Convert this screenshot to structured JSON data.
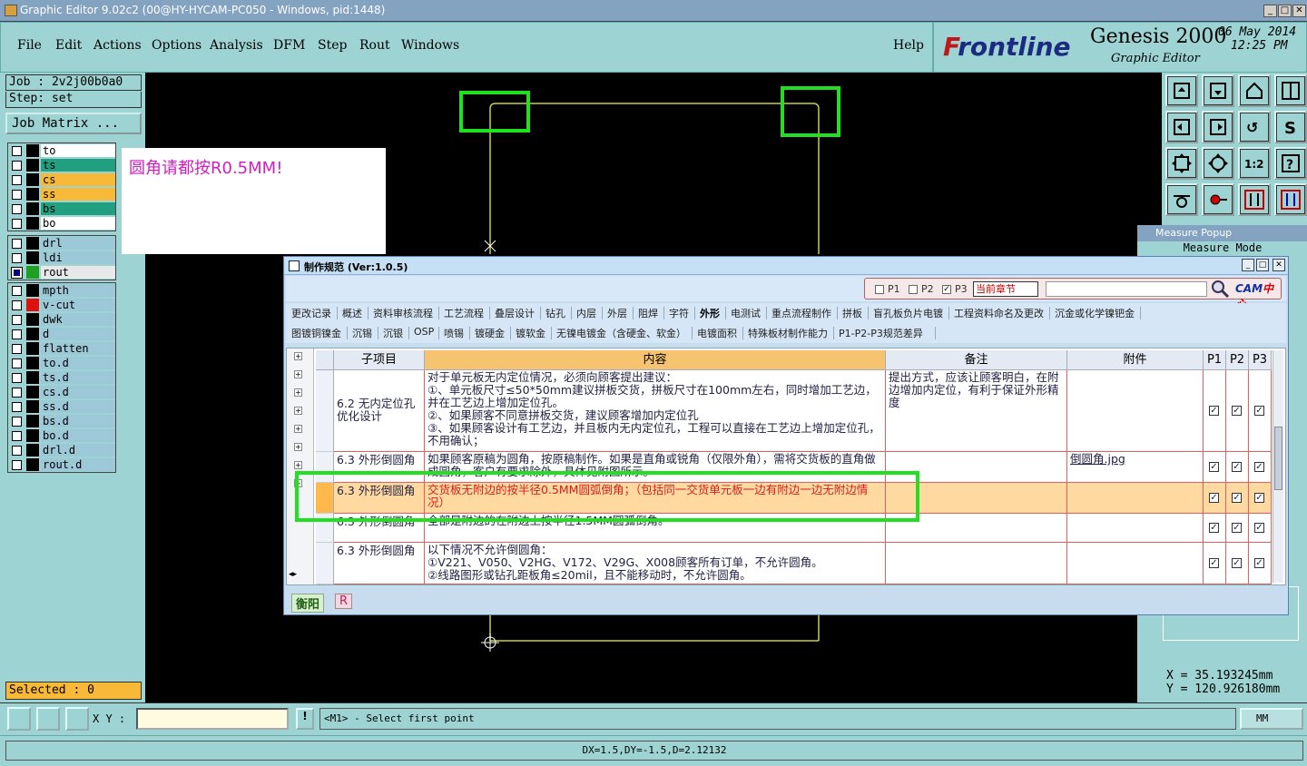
{
  "titlebar": {
    "title": "Graphic Editor 9.02c2 (00@HY-HYCAM-PC050 - Windows, pid:1448)"
  },
  "menu": {
    "items": [
      "File",
      "Edit",
      "Actions",
      "Options",
      "Analysis",
      "DFM",
      "Step",
      "Rout",
      "Windows"
    ],
    "help": "Help"
  },
  "brand": {
    "logo_a": "F",
    "logo_b": "r",
    "logo_c": "ontline",
    "product": "Genesis 2000",
    "subtitle": "Graphic Editor",
    "date": "06 May 2014",
    "time": "12:25 PM"
  },
  "job": {
    "job_text": "Job : 2v2j00b0a0",
    "step_text": "Step: set",
    "matrix_btn": "Job Matrix ..."
  },
  "layers": {
    "group1": [
      {
        "name": "to",
        "color": "#ffffff"
      },
      {
        "name": "ts",
        "color": "#20a080"
      },
      {
        "name": "cs",
        "color": "#f8b838"
      },
      {
        "name": "ss",
        "color": "#f8b838"
      },
      {
        "name": "bs",
        "color": "#20a080"
      },
      {
        "name": "bo",
        "color": "#ffffff"
      }
    ],
    "group2": [
      {
        "name": "drl",
        "color": "#9dc8d8"
      },
      {
        "name": "ldi",
        "color": "#9dc8d8"
      },
      {
        "name": "rout",
        "color": "#e8e8e8"
      }
    ],
    "group3": [
      {
        "name": "mpth",
        "color": "#9dc8d8"
      },
      {
        "name": "v-cut",
        "color": "#9dc8d8"
      },
      {
        "name": "dwk",
        "color": "#9dc8d8"
      },
      {
        "name": "d",
        "color": "#9dc8d8"
      },
      {
        "name": "flatten",
        "color": "#9dc8d8"
      },
      {
        "name": "to.d",
        "color": "#9dc8d8"
      },
      {
        "name": "ts.d",
        "color": "#9dc8d8"
      },
      {
        "name": "cs.d",
        "color": "#9dc8d8"
      },
      {
        "name": "ss.d",
        "color": "#9dc8d8"
      },
      {
        "name": "bs.d",
        "color": "#9dc8d8"
      },
      {
        "name": "bo.d",
        "color": "#9dc8d8"
      },
      {
        "name": "drl.d",
        "color": "#9dc8d8"
      },
      {
        "name": "rout.d",
        "color": "#9dc8d8"
      }
    ]
  },
  "selected": "Selected : 0",
  "note": "圆角请都按R0.5MM!",
  "measure": {
    "title": "Measure Popup",
    "mode": "Measure Mode",
    "x": "X = 35.193245mm",
    "y": "Y = 120.926180mm"
  },
  "bottom": {
    "xy_label": "X Y :",
    "prompt": "<M1> - Select first point",
    "units": "MM",
    "status": "DX=1.5,DY=-1.5,D=2.12132"
  },
  "dialog": {
    "title": "制作规范 (Ver:1.0.5)",
    "filters": [
      "P1",
      "P2",
      "P3"
    ],
    "chapter": "当前章节",
    "cam_a": "CAM",
    "cam_b": "中心",
    "tabs1": [
      "更改记录",
      "概述",
      "资料审核流程",
      "工艺流程",
      "叠层设计",
      "钻孔",
      "内层",
      "外层",
      "阻焊",
      "字符",
      "外形",
      "电测试",
      "重点流程制作",
      "拼板",
      "盲孔板负片电镀",
      "工程资料命名及更改",
      "沉金或化学镍钯金"
    ],
    "tabs2": [
      "图镀铜镍金",
      "沉锡",
      "沉银",
      "OSP",
      "喷锡",
      "镀硬金",
      "镀软金",
      "无镍电镀金（含硬金、软金）",
      "电镀面积",
      "特殊板材制作能力",
      "P1-P2-P3规范差异"
    ],
    "active_tab": "外形",
    "headers": [
      "子项目",
      "内容",
      "备注",
      "附件",
      "P1",
      "P2",
      "P3"
    ],
    "rows": [
      {
        "sub": "6.2 无内定位孔优化设计",
        "content": "对于单元板无内定位情况，必须向顾客提出建议：\n①、单元板尺寸≤50*50mm建议拼板交货，拼板尺寸在100mm左右，同时增加工艺边，并在工艺边上增加定位孔。\n②、如果顾客不同意拼板交货，建议顾客增加内定位孔\n③、如果顾客设计有工艺边，并且板内无内定位孔，工程可以直接在工艺边上增加定位孔，不用确认；",
        "note": "提出方式，应该让顾客明白，在附边增加内定位，有利于保证外形精度",
        "attach": ""
      },
      {
        "sub": "6.3 外形倒圆角",
        "content": "如果顾客原稿为圆角，按原稿制作。如果是直角或锐角（仅限外角），需将交货板的直角做成圆角，客户有要求除外，具体见附图所示。",
        "note": "",
        "attach": "倒圆角.jpg"
      },
      {
        "sub": "6.3 外形倒圆角",
        "content": "交货板无附边的按半径0.5MM圆弧倒角；（包括同一交货单元板一边有附边一边无附边情况）",
        "note": "",
        "attach": ""
      },
      {
        "sub": "6.3 外形倒圆角",
        "content": "全部是附边的在附边上按半径1.5MM圆弧倒角。",
        "note": "",
        "attach": ""
      },
      {
        "sub": "6.3 外形倒圆角",
        "content": "以下情况不允许倒圆角：\n①V221、V050、V2HG、V172、V29G、X008顾客所有订单，不允许圆角。\n②线路图形或钻孔距板角≤20mil，且不能移动时，不允许圆角。",
        "note": "",
        "attach": ""
      }
    ],
    "bottom_tab": "衡阳",
    "bottom_tab2": "R"
  }
}
